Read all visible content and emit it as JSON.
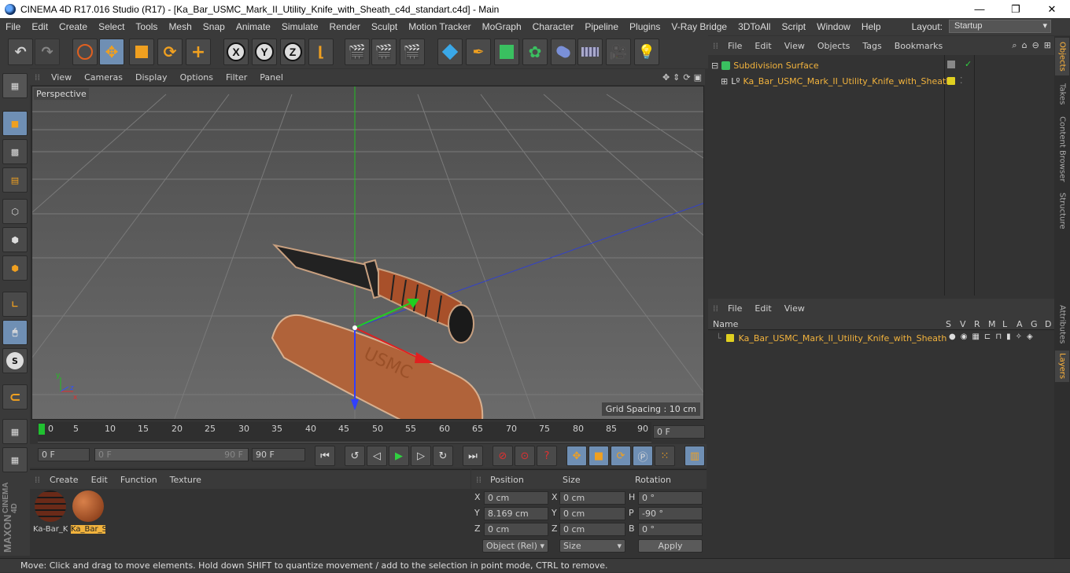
{
  "window": {
    "title": "CINEMA 4D R17.016 Studio (R17) - [Ka_Bar_USMC_Mark_II_Utility_Knife_with_Sheath_c4d_standart.c4d] - Main",
    "minimize": "—",
    "maximize": "❐",
    "close": "✕"
  },
  "menu": [
    "File",
    "Edit",
    "Create",
    "Select",
    "Tools",
    "Mesh",
    "Snap",
    "Animate",
    "Simulate",
    "Render",
    "Sculpt",
    "Motion Tracker",
    "MoGraph",
    "Character",
    "Pipeline",
    "Plugins",
    "V-Ray Bridge",
    "3DToAll",
    "Script",
    "Window",
    "Help"
  ],
  "layout": {
    "label": "Layout:",
    "value": "Startup"
  },
  "toolbar": {
    "x": "X",
    "y": "Y",
    "z": "Z"
  },
  "viewport": {
    "menu": [
      "View",
      "Cameras",
      "Display",
      "Options",
      "Filter",
      "Panel"
    ],
    "camera": "Perspective",
    "grid_spacing": "Grid Spacing : 10 cm"
  },
  "timeline": {
    "ticks": [
      "0",
      "5",
      "10",
      "15",
      "20",
      "25",
      "30",
      "35",
      "40",
      "45",
      "50",
      "55",
      "60",
      "65",
      "70",
      "75",
      "80",
      "85",
      "90"
    ],
    "current_frame": "0 F"
  },
  "transport": {
    "start": "0 F",
    "range_start": "0 F",
    "range_end": "90 F",
    "end": "90 F"
  },
  "materials": {
    "menu": [
      "Create",
      "Edit",
      "Function",
      "Texture"
    ],
    "items": [
      {
        "label": "Ka-Bar_K"
      },
      {
        "label": "Ka_Bar_S"
      }
    ]
  },
  "coords": {
    "headers": {
      "position": "Position",
      "size": "Size",
      "rotation": "Rotation"
    },
    "rows": [
      {
        "axis": "X",
        "pos": "0 cm",
        "saxis": "X",
        "size": "0 cm",
        "raxis": "H",
        "rot": "0 °"
      },
      {
        "axis": "Y",
        "pos": "8.169 cm",
        "saxis": "Y",
        "size": "0 cm",
        "raxis": "P",
        "rot": "-90 °"
      },
      {
        "axis": "Z",
        "pos": "0 cm",
        "saxis": "Z",
        "size": "0 cm",
        "raxis": "B",
        "rot": "0 °"
      }
    ],
    "mode": "Object (Rel)",
    "size_mode": "Size",
    "apply": "Apply"
  },
  "objects": {
    "menu": [
      "File",
      "Edit",
      "View",
      "Objects",
      "Tags",
      "Bookmarks"
    ],
    "items": [
      {
        "name": "Subdivision Surface"
      },
      {
        "name": "Ka_Bar_USMC_Mark_II_Utility_Knife_with_Sheath"
      }
    ]
  },
  "layers": {
    "menu": [
      "File",
      "Edit",
      "View"
    ],
    "columns": [
      "Name",
      "S",
      "V",
      "R",
      "M",
      "L",
      "A",
      "G",
      "D"
    ],
    "items": [
      {
        "name": "Ka_Bar_USMC_Mark_II_Utility_Knife_with_Sheath"
      }
    ]
  },
  "sidetabs": {
    "top": [
      "Objects",
      "Takes",
      "Content Browser",
      "Structure"
    ],
    "bottom": [
      "Attributes",
      "Layers"
    ]
  },
  "brand": {
    "maxon": "MAXON",
    "product": "CINEMA 4D"
  },
  "status": "Move: Click and drag to move elements. Hold down SHIFT to quantize movement / add to the selection in point mode, CTRL to remove.",
  "colors": {
    "accent": "#f2b33d",
    "active_tool": "#6f8fb4",
    "layer_dot": "#e0d020"
  }
}
